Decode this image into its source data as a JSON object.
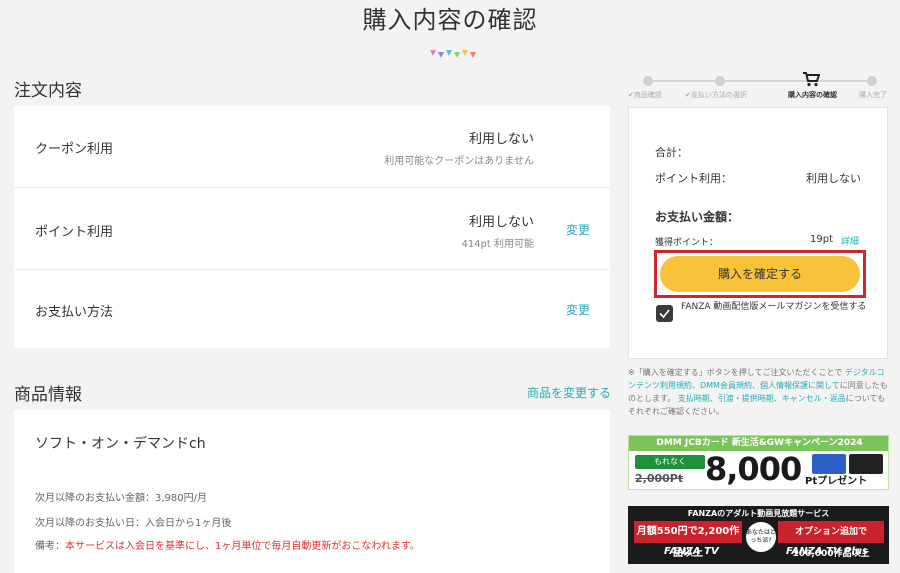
{
  "page": {
    "title": "購入内容の確認"
  },
  "order": {
    "section_title": "注文内容",
    "rows": [
      {
        "label": "クーポン利用",
        "value": "利用しない",
        "sub": "利用可能なクーポンはありません",
        "change": ""
      },
      {
        "label": "ポイント利用",
        "value": "利用しない",
        "sub": "414pt 利用可能",
        "change": "変更"
      },
      {
        "label": "お支払い方法",
        "value": "",
        "sub": "",
        "change": "変更"
      }
    ]
  },
  "product": {
    "section_title": "商品情報",
    "change_link": "商品を変更する",
    "name": "ソフト・オン・デマンドch",
    "next_amount": "次月以降のお支払い金額：3,980円/月",
    "next_date": "次月以降のお支払い日：入会日から1ヶ月後",
    "note_label": "備考：",
    "note_text": "本サービスは入会日を基準にし、1ヶ月単位で毎月自動更新がおこなわれます。"
  },
  "stepper": {
    "steps": [
      {
        "label": "✔商品確認",
        "active": false
      },
      {
        "label": "✔支払い方法の選択",
        "active": false
      },
      {
        "label": "購入内容の確認",
        "active": true
      },
      {
        "label": "購入完了",
        "active": false
      }
    ]
  },
  "summary": {
    "total_label": "合計：",
    "points_label": "ポイント利用：",
    "points_value": "利用しない",
    "pay_label": "お支払い金額：",
    "earned_label": "獲得ポイント：",
    "earned_value": "19pt",
    "earned_link": "詳細",
    "confirm_button": "購入を確定する",
    "mail_text": "FANZA 動画配信版メールマガジンを受信する"
  },
  "notice": {
    "t1": "※「購入を確定する」ボタンを押してご注文いただくことで ",
    "l1": "デジタルコンテンツ利用規約、DMM会員規約、個人情報保護に関して",
    "t2": "に同意したものとします。 ",
    "l2": "支払時期、引渡・提供時期",
    "t3": "、",
    "l3": "キャンセル・返品",
    "t4": "についてもそれぞれご確認ください。"
  },
  "banner1": {
    "top": "DMM JCBカード 新生活&GWキャンペーン2024",
    "badge": "もれなく",
    "old": "2,000Pt",
    "big": "8,000",
    "pt": "Ptプレゼント"
  },
  "banner2": {
    "top": "FANZAのアダルト動画見放題サービス",
    "left": "月額550円で2,200作品以上",
    "circle": "あなたはどっち派?",
    "right": "オプション追加で100,000作品以上",
    "logo1": "FANZA TV",
    "logo2": "FANZA TV Plus"
  },
  "colors": {
    "accent_link": "#27a9b8",
    "confirm_button": "#f8c33a",
    "highlight_border": "#c8282e",
    "note_red": "#dd3333"
  }
}
